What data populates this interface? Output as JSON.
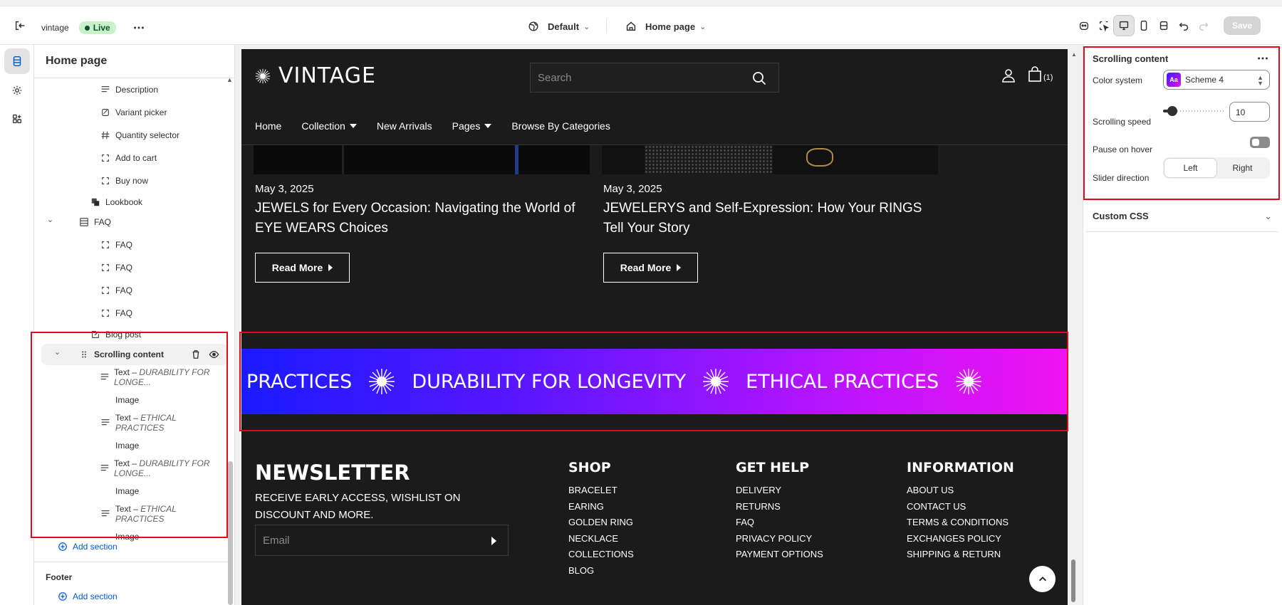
{
  "topbar": {
    "store_name": "vintage",
    "live_label": "Live",
    "theme_label": "Default",
    "page_label": "Home page",
    "save_label": "Save"
  },
  "sidebar": {
    "title": "Home page",
    "tree": [
      {
        "label": "Description",
        "icon": "text-lines-icon"
      },
      {
        "label": "Variant picker",
        "icon": "variant-icon"
      },
      {
        "label": "Quantity selector",
        "icon": "hash-icon"
      },
      {
        "label": "Add to cart",
        "icon": "block-frame-icon"
      },
      {
        "label": "Buy now",
        "icon": "block-frame-icon"
      },
      {
        "label": "Lookbook",
        "icon": "stack-icon"
      },
      {
        "label": "FAQ",
        "icon": "accordion-icon"
      },
      {
        "label": "FAQ",
        "icon": "block-frame-icon"
      },
      {
        "label": "FAQ",
        "icon": "block-frame-icon"
      },
      {
        "label": "FAQ",
        "icon": "block-frame-icon"
      },
      {
        "label": "FAQ",
        "icon": "block-frame-icon"
      },
      {
        "label": "Blog post",
        "icon": "edit-icon"
      },
      {
        "label": "Scrolling content",
        "icon": "drag-handle-icon"
      },
      {
        "prefix": "Text – ",
        "label": "DURABILITY FOR LONGE...",
        "icon": "text-lines-icon"
      },
      {
        "label": "Image"
      },
      {
        "prefix": "Text – ",
        "label": "ETHICAL PRACTICES",
        "icon": "text-lines-icon"
      },
      {
        "label": "Image"
      },
      {
        "prefix": "Text – ",
        "label": "DURABILITY FOR LONGE...",
        "icon": "text-lines-icon"
      },
      {
        "label": "Image"
      },
      {
        "prefix": "Text – ",
        "label": "ETHICAL PRACTICES",
        "icon": "text-lines-icon"
      },
      {
        "label": "Image"
      }
    ],
    "add_section": "Add section",
    "footer_title": "Footer",
    "footer_add_section": "Add section"
  },
  "store": {
    "logo": "VINTAGE",
    "search_placeholder": "Search",
    "cart_count": "(1)",
    "nav": [
      "Home",
      "Collection",
      "New Arrivals",
      "Pages",
      "Browse By Categories"
    ],
    "posts": [
      {
        "date": "May 3, 2025",
        "title": "JEWELS for Every Occasion: Navigating the World of EYE WEARS Choices",
        "button": "Read More"
      },
      {
        "date": "May 3, 2025",
        "title": "JEWELERYS and Self-Expression: How Your RINGS Tell Your Story",
        "button": "Read More"
      }
    ],
    "marquee": [
      "PRACTICES",
      "DURABILITY FOR LONGEVITY",
      "ETHICAL PRACTICES"
    ],
    "newsletter": {
      "title": "NEWSLETTER",
      "text": "RECEIVE EARLY ACCESS, WISHLIST ON DISCOUNT AND MORE.",
      "email_placeholder": "Email"
    },
    "footer_cols": [
      {
        "title": "SHOP",
        "links": [
          "BRACELET",
          "EARING",
          "GOLDEN RING",
          "NECKLACE",
          "COLLECTIONS",
          "BLOG"
        ]
      },
      {
        "title": "GET HELP",
        "links": [
          "DELIVERY",
          "RETURNS",
          "FAQ",
          "PRIVACY POLICY",
          "PAYMENT OPTIONS"
        ]
      },
      {
        "title": "INFORMATION",
        "links": [
          "ABOUT US",
          "CONTACT US",
          "TERMS & CONDITIONS",
          "EXCHANGES POLICY",
          "SHIPPING & RETURN"
        ]
      }
    ]
  },
  "settings": {
    "title": "Scrolling content",
    "color_system_label": "Color system",
    "color_system_value": "Scheme 4",
    "swatch_text": "Aa",
    "scrolling_speed_label": "Scrolling speed",
    "scrolling_speed_value": "10",
    "pause_on_hover_label": "Pause on hover",
    "pause_on_hover": false,
    "slider_direction_label": "Slider direction",
    "direction_left": "Left",
    "direction_right": "Right",
    "direction_selected": "Left",
    "custom_css_label": "Custom CSS"
  },
  "colors": {
    "highlight": "#e00b1c",
    "live_bg": "#c9f2c8",
    "marquee_start": "#1a1aff",
    "marquee_end": "#f013f0",
    "store_bg": "#1b1b1b"
  }
}
